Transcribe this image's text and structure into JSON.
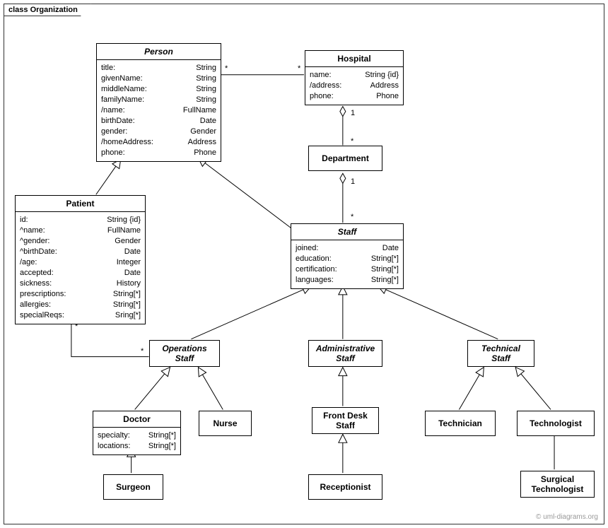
{
  "frame": {
    "title": "class Organization"
  },
  "watermark": "© uml-diagrams.org",
  "classes": {
    "person": {
      "name": "Person",
      "attrs": [
        {
          "n": "title:",
          "t": "String"
        },
        {
          "n": "givenName:",
          "t": "String"
        },
        {
          "n": "middleName:",
          "t": "String"
        },
        {
          "n": "familyName:",
          "t": "String"
        },
        {
          "n": "/name:",
          "t": "FullName"
        },
        {
          "n": "birthDate:",
          "t": "Date"
        },
        {
          "n": "gender:",
          "t": "Gender"
        },
        {
          "n": "/homeAddress:",
          "t": "Address"
        },
        {
          "n": "phone:",
          "t": "Phone"
        }
      ]
    },
    "hospital": {
      "name": "Hospital",
      "attrs": [
        {
          "n": "name:",
          "t": "String {id}"
        },
        {
          "n": "/address:",
          "t": "Address"
        },
        {
          "n": "phone:",
          "t": "Phone"
        }
      ]
    },
    "department": {
      "name": "Department"
    },
    "patient": {
      "name": "Patient",
      "attrs": [
        {
          "n": "id:",
          "t": "String {id}"
        },
        {
          "n": "^name:",
          "t": "FullName"
        },
        {
          "n": "^gender:",
          "t": "Gender"
        },
        {
          "n": "^birthDate:",
          "t": "Date"
        },
        {
          "n": "/age:",
          "t": "Integer"
        },
        {
          "n": "accepted:",
          "t": "Date"
        },
        {
          "n": "sickness:",
          "t": "History"
        },
        {
          "n": "prescriptions:",
          "t": "String[*]"
        },
        {
          "n": "allergies:",
          "t": "String[*]"
        },
        {
          "n": "specialReqs:",
          "t": "Sring[*]"
        }
      ]
    },
    "staff": {
      "name": "Staff",
      "attrs": [
        {
          "n": "joined:",
          "t": "Date"
        },
        {
          "n": "education:",
          "t": "String[*]"
        },
        {
          "n": "certification:",
          "t": "String[*]"
        },
        {
          "n": "languages:",
          "t": "String[*]"
        }
      ]
    },
    "operations_staff": {
      "name": "Operations\nStaff"
    },
    "administrative_staff": {
      "name": "Administrative\nStaff"
    },
    "technical_staff": {
      "name": "Technical\nStaff"
    },
    "doctor": {
      "name": "Doctor",
      "attrs": [
        {
          "n": "specialty:",
          "t": "String[*]"
        },
        {
          "n": "locations:",
          "t": "String[*]"
        }
      ]
    },
    "nurse": {
      "name": "Nurse"
    },
    "front_desk_staff": {
      "name": "Front Desk\nStaff"
    },
    "receptionist": {
      "name": "Receptionist"
    },
    "technician": {
      "name": "Technician"
    },
    "technologist": {
      "name": "Technologist"
    },
    "surgical_technologist": {
      "name": "Surgical\nTechnologist"
    },
    "surgeon": {
      "name": "Surgeon"
    }
  },
  "multiplicities": {
    "person_hospital_left": "*",
    "person_hospital_right": "*",
    "hospital_dept_top": "1",
    "hospital_dept_bottom": "*",
    "dept_staff_top": "1",
    "dept_staff_bottom": "*",
    "patient_ops_left": "*",
    "patient_ops_right": "*"
  }
}
